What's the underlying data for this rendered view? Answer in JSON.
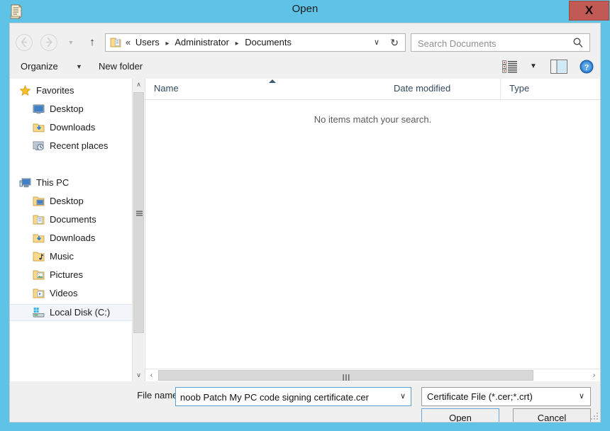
{
  "window": {
    "title": "Open",
    "title_icon": "certificate-icon",
    "close_label": "X",
    "accent_color": "#5fc3e8",
    "close_color": "#c15a54"
  },
  "nav": {
    "back_glyph": "←",
    "forward_glyph": "→",
    "recent_glyph": "▼",
    "up_glyph": "↑",
    "breadcrumb": {
      "prefix": "«",
      "crumbs": [
        "Users",
        "Administrator",
        "Documents"
      ],
      "separator": "▸",
      "chevron": "∨",
      "refresh": "↻"
    },
    "search": {
      "placeholder": "Search Documents",
      "value": ""
    }
  },
  "toolbar": {
    "organize_label": "Organize",
    "organize_caret": "▼",
    "new_folder_label": "New folder",
    "view_caret": "▼"
  },
  "sidebar": {
    "items": [
      {
        "label": "Favorites",
        "icon": "star-icon",
        "level": "group",
        "selected": false
      },
      {
        "label": "Desktop",
        "icon": "monitor-icon",
        "level": "child",
        "selected": false
      },
      {
        "label": "Downloads",
        "icon": "downloads-icon",
        "level": "child",
        "selected": false
      },
      {
        "label": "Recent places",
        "icon": "recent-places-icon",
        "level": "child",
        "selected": false
      },
      {
        "label": "This PC",
        "icon": "computer-icon",
        "level": "group",
        "selected": false
      },
      {
        "label": "Desktop",
        "icon": "desktop-folder-icon",
        "level": "child",
        "selected": false
      },
      {
        "label": "Documents",
        "icon": "documents-icon",
        "level": "child",
        "selected": false
      },
      {
        "label": "Downloads",
        "icon": "downloads-icon",
        "level": "child",
        "selected": false
      },
      {
        "label": "Music",
        "icon": "music-icon",
        "level": "child",
        "selected": false
      },
      {
        "label": "Pictures",
        "icon": "pictures-icon",
        "level": "child",
        "selected": false
      },
      {
        "label": "Videos",
        "icon": "videos-icon",
        "level": "child",
        "selected": false
      },
      {
        "label": "Local Disk (C:)",
        "icon": "harddisk-icon",
        "level": "child",
        "selected": true
      }
    ],
    "scroll_up": "∧",
    "scroll_down": "∨"
  },
  "filelist": {
    "columns": [
      "Name",
      "Date modified",
      "Type"
    ],
    "sort_column": "Name",
    "sort_direction": "ascending",
    "rows": [],
    "empty_message": "No items match your search.",
    "hscroll_left": "‹",
    "hscroll_right": "›"
  },
  "bottom": {
    "filename_label": "File name:",
    "filename_value": "noob Patch My PC code signing certificate.cer",
    "filename_caret": "∨",
    "filetype_value": "Certificate File (*.cer;*.crt)",
    "filetype_caret": "∨",
    "open_label": "Open",
    "open_accesskey": "O",
    "open_rest": "pen",
    "cancel_label": "Cancel"
  }
}
